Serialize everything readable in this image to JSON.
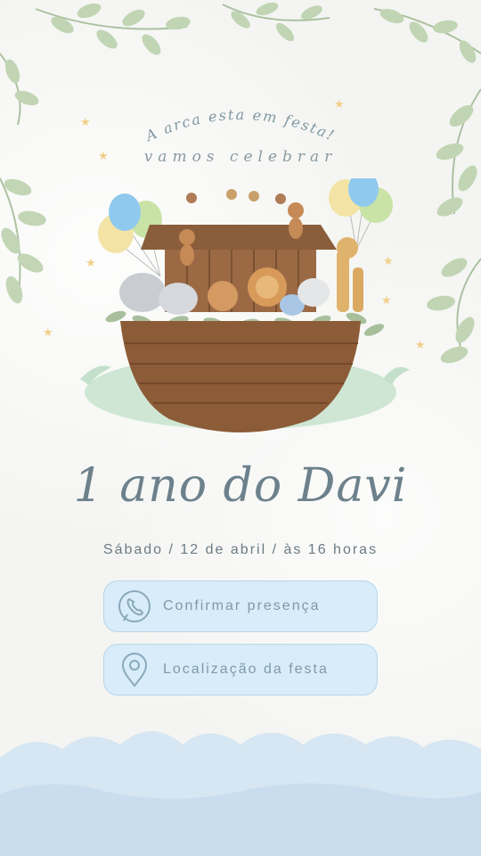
{
  "header": {
    "curved_title": "A arca esta em festa!",
    "subtitle": "vamos celebrar"
  },
  "invite": {
    "name": "1 ano do Davi",
    "date_line": "Sábado / 12 de abril / às 16 horas"
  },
  "actions": {
    "confirm_label": "Confirmar presença",
    "location_label": "Localização da festa"
  },
  "icons": {
    "confirm": "phone-icon",
    "location": "location-pin-icon"
  },
  "colors": {
    "leaf": "#a8c49a",
    "button_bg": "#d8ecf9",
    "text": "#6d818c",
    "water": "#c9ddef"
  }
}
